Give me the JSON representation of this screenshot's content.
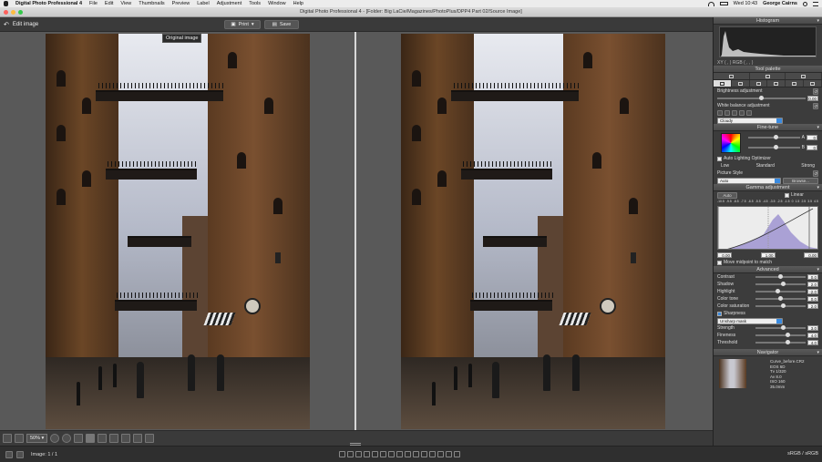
{
  "menubar": {
    "app_name": "Digital Photo Professional 4",
    "items": [
      "File",
      "Edit",
      "View",
      "Thumbnails",
      "Preview",
      "Label",
      "Adjustment",
      "Tools",
      "Window",
      "Help"
    ],
    "time": "Wed 10:43",
    "user": "George Cairns"
  },
  "window": {
    "title": "Digital Photo Professional 4 - [Folder: Big LaCie/Magazines/PhotoPlus/DPP4 Part 02/Source Image]"
  },
  "toolbar": {
    "edit_image_label": "Edit image",
    "print_label": "Print",
    "save_label": "Save"
  },
  "viewer": {
    "original_label": "Original image"
  },
  "bottombar": {
    "zoom_value": "50%"
  },
  "statusbar": {
    "image_count": "Image: 1 / 1",
    "color_space": "sRGB / sRGB"
  },
  "panel": {
    "histogram": {
      "title": "Histogram",
      "readout": "XY (    ,    )  RGB (    ,    ,    )"
    },
    "tool_palette": {
      "title": "Tool palette"
    },
    "brightness": {
      "label": "Brightness adjustment",
      "value": "0.00",
      "position": 0.5
    },
    "white_balance": {
      "label": "White balance adjustment",
      "mode": "Cloudy"
    },
    "fine_tune": {
      "title": "Fine-tune",
      "a_label": "A",
      "a_value": "0",
      "b_label": "B",
      "b_value": "0",
      "auto_lighting_label": "Auto Lighting Optimizer",
      "low_label": "Low",
      "standard_label": "Standard",
      "strong_label": "Strong"
    },
    "picture_style": {
      "label": "Picture Style",
      "value": "Auto",
      "browse_label": "Browse..."
    },
    "gamma": {
      "title": "Gamma adjustment",
      "auto_label": "Auto",
      "linear_label": "Linear",
      "scale": [
        "-10.5",
        "-9.5",
        "-8.5",
        "-7.5",
        "-6.5",
        "-5.5",
        "-4.5",
        "-3.5",
        "-2.5",
        "-1.5",
        "0",
        "1.5",
        "2.5",
        "3.5",
        "4.5"
      ],
      "left_value": "0.00",
      "mid_value": "1.00",
      "right_value": "0.00",
      "move_midpoint_label": "Move midpoint to match"
    },
    "advanced": {
      "title": "Advanced",
      "rows": [
        {
          "label": "Contrast",
          "value": "0.0",
          "position": 0.5
        },
        {
          "label": "Shadow",
          "value": "2.0",
          "position": 0.55
        },
        {
          "label": "Highlight",
          "value": "-2.0",
          "position": 0.45
        },
        {
          "label": "Color tone",
          "value": "0.0",
          "position": 0.5
        },
        {
          "label": "Color saturation",
          "value": "2.0",
          "position": 0.55
        }
      ]
    },
    "sharpness": {
      "label": "Sharpness",
      "mode": "Unsharp mask",
      "rows": [
        {
          "label": "Strength",
          "value": "3.0",
          "position": 0.55
        },
        {
          "label": "Fineness",
          "value": "4.0",
          "position": 0.65
        },
        {
          "label": "Threshold",
          "value": "4.0",
          "position": 0.65
        }
      ]
    },
    "navigator": {
      "title": "Navigator",
      "filename": "Curve_before.CR2",
      "camera": "EOS 6D",
      "shutter": "Tv 1/320",
      "aperture": "Av 8.0",
      "iso": "ISO 160",
      "focal": "35.0mm"
    }
  },
  "colors": {
    "accent": "#3a8be0",
    "panel_bg": "#3c3c3c",
    "viewer_bg": "#595959"
  }
}
